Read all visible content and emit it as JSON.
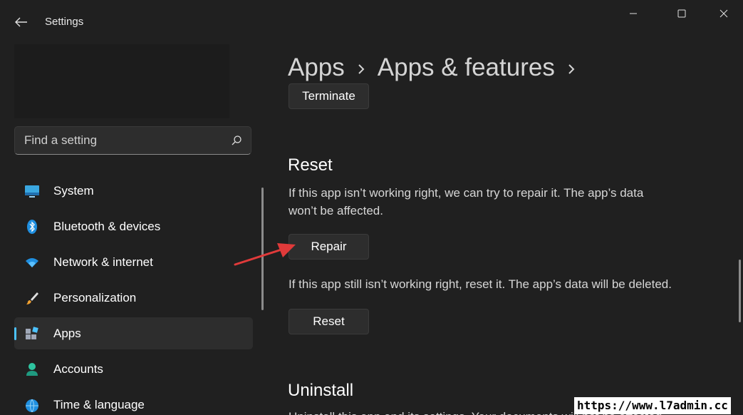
{
  "window": {
    "title": "Settings"
  },
  "search": {
    "placeholder": "Find a setting"
  },
  "sidebar": {
    "items": [
      {
        "label": "System",
        "icon": "monitor-icon",
        "active": false
      },
      {
        "label": "Bluetooth & devices",
        "icon": "bluetooth-icon",
        "active": false
      },
      {
        "label": "Network & internet",
        "icon": "wifi-icon",
        "active": false
      },
      {
        "label": "Personalization",
        "icon": "brush-icon",
        "active": false
      },
      {
        "label": "Apps",
        "icon": "apps-icon",
        "active": true
      },
      {
        "label": "Accounts",
        "icon": "person-icon",
        "active": false
      },
      {
        "label": "Time & language",
        "icon": "globe-icon",
        "active": false
      }
    ]
  },
  "breadcrumb": {
    "items": [
      "Apps",
      "Apps & features"
    ]
  },
  "main": {
    "terminate_label": "Terminate",
    "reset_section": {
      "title": "Reset",
      "repair_description": "If this app isn’t working right, we can try to repair it. The app’s data won’t be affected.",
      "repair_label": "Repair",
      "reset_description": "If this app still isn’t working right, reset it. The app’s data will be deleted.",
      "reset_label": "Reset"
    },
    "uninstall_section": {
      "title": "Uninstall",
      "description": "Uninstall this app and its settings. Your documents will not be affected."
    }
  },
  "watermark": "https://www.l7admin.cc",
  "colors": {
    "background": "#202020",
    "accent": "#4cc2ff",
    "annotation_arrow": "#e03a3a"
  }
}
